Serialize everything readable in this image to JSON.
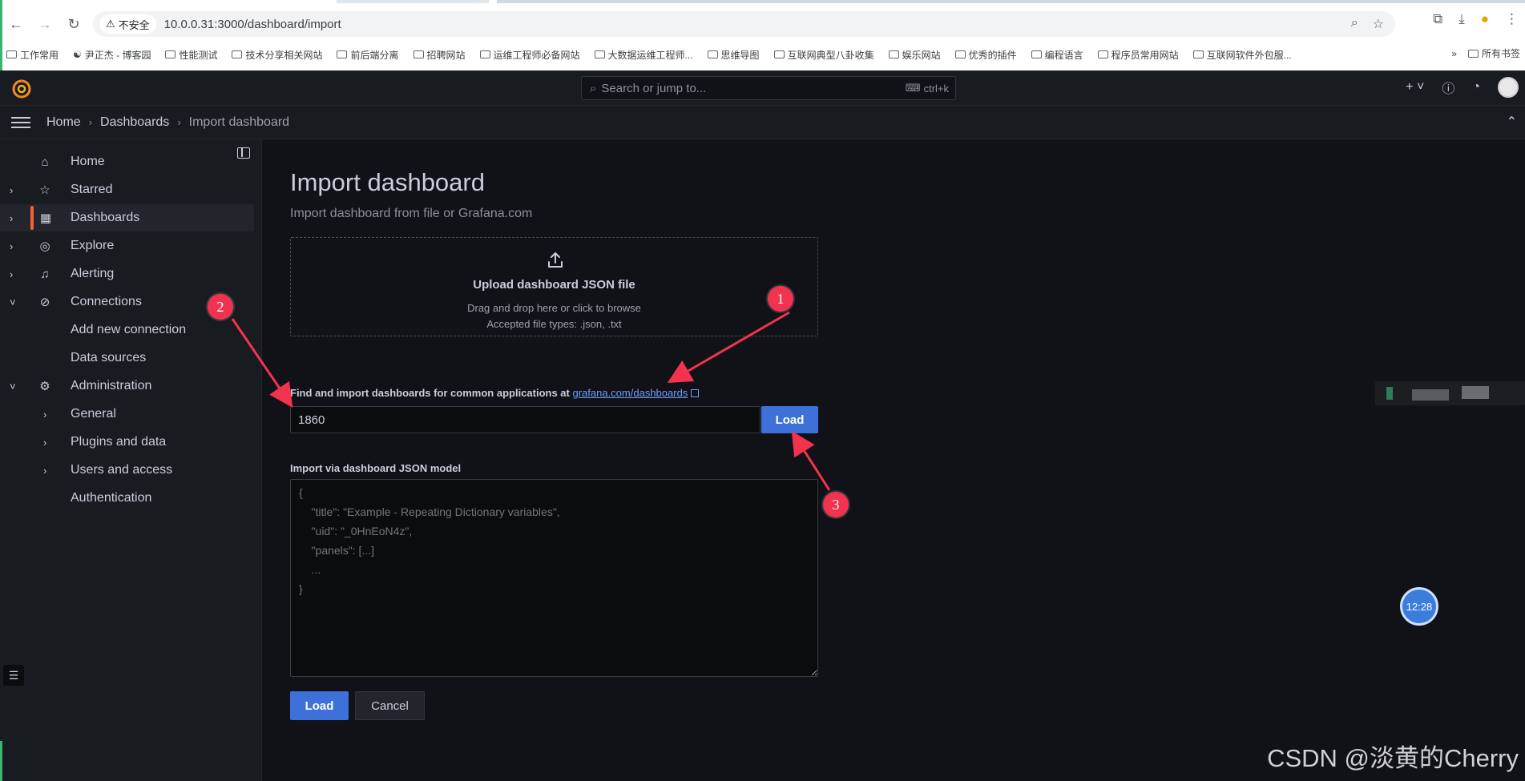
{
  "browser": {
    "security_label": "不安全",
    "url": "10.0.0.31:3000/dashboard/import",
    "bookmarks": [
      "工作常用",
      "尹正杰 - 博客园",
      "性能测试",
      "技术分享相关网站",
      "前后端分离",
      "招聘网站",
      "运维工程师必备网站",
      "大数据运维工程师...",
      "思维导图",
      "互联网典型八卦收集",
      "娱乐网站",
      "优秀的插件",
      "编程语言",
      "程序员常用网站",
      "互联网软件外包服..."
    ],
    "bookmarks_more": "»",
    "all_bookmarks": "所有书签"
  },
  "topbar": {
    "search_placeholder": "Search or jump to...",
    "shortcut": "ctrl+k"
  },
  "breadcrumb": {
    "home": "Home",
    "dashboards": "Dashboards",
    "current": "Import dashboard"
  },
  "sidebar": {
    "items": [
      {
        "label": "Home"
      },
      {
        "label": "Starred"
      },
      {
        "label": "Dashboards"
      },
      {
        "label": "Explore"
      },
      {
        "label": "Alerting"
      },
      {
        "label": "Connections"
      },
      {
        "label": "Add new connection"
      },
      {
        "label": "Data sources"
      },
      {
        "label": "Administration"
      },
      {
        "label": "General"
      },
      {
        "label": "Plugins and data"
      },
      {
        "label": "Users and access"
      },
      {
        "label": "Authentication"
      }
    ]
  },
  "main": {
    "title": "Import dashboard",
    "subtitle": "Import dashboard from file or Grafana.com",
    "upload_title": "Upload dashboard JSON file",
    "upload_hint": "Drag and drop here or click to browse",
    "upload_types": "Accepted file types: .json, .txt",
    "find_label": "Find and import dashboards for common applications at ",
    "find_link": "grafana.com/dashboards",
    "dashboard_id": "1860",
    "load_label": "Load",
    "json_label": "Import via dashboard JSON model",
    "json_placeholder": "{\n    \"title\": \"Example - Repeating Dictionary variables\",\n    \"uid\": \"_0HnEoN4z\",\n    \"panels\": [...]\n    ...\n}",
    "load_button": "Load",
    "cancel_button": "Cancel"
  },
  "annotations": {
    "badge1": "1",
    "badge2": "2",
    "badge3": "3"
  },
  "widgets": {
    "clock": "12:28"
  },
  "watermark": "CSDN @淡黄的Cherry",
  "colors": {
    "accent": "#3d71d9",
    "active_indicator": "#f55f3e",
    "annotation_red": "#f2334f",
    "background": "#111217",
    "panel": "#181b1f"
  }
}
